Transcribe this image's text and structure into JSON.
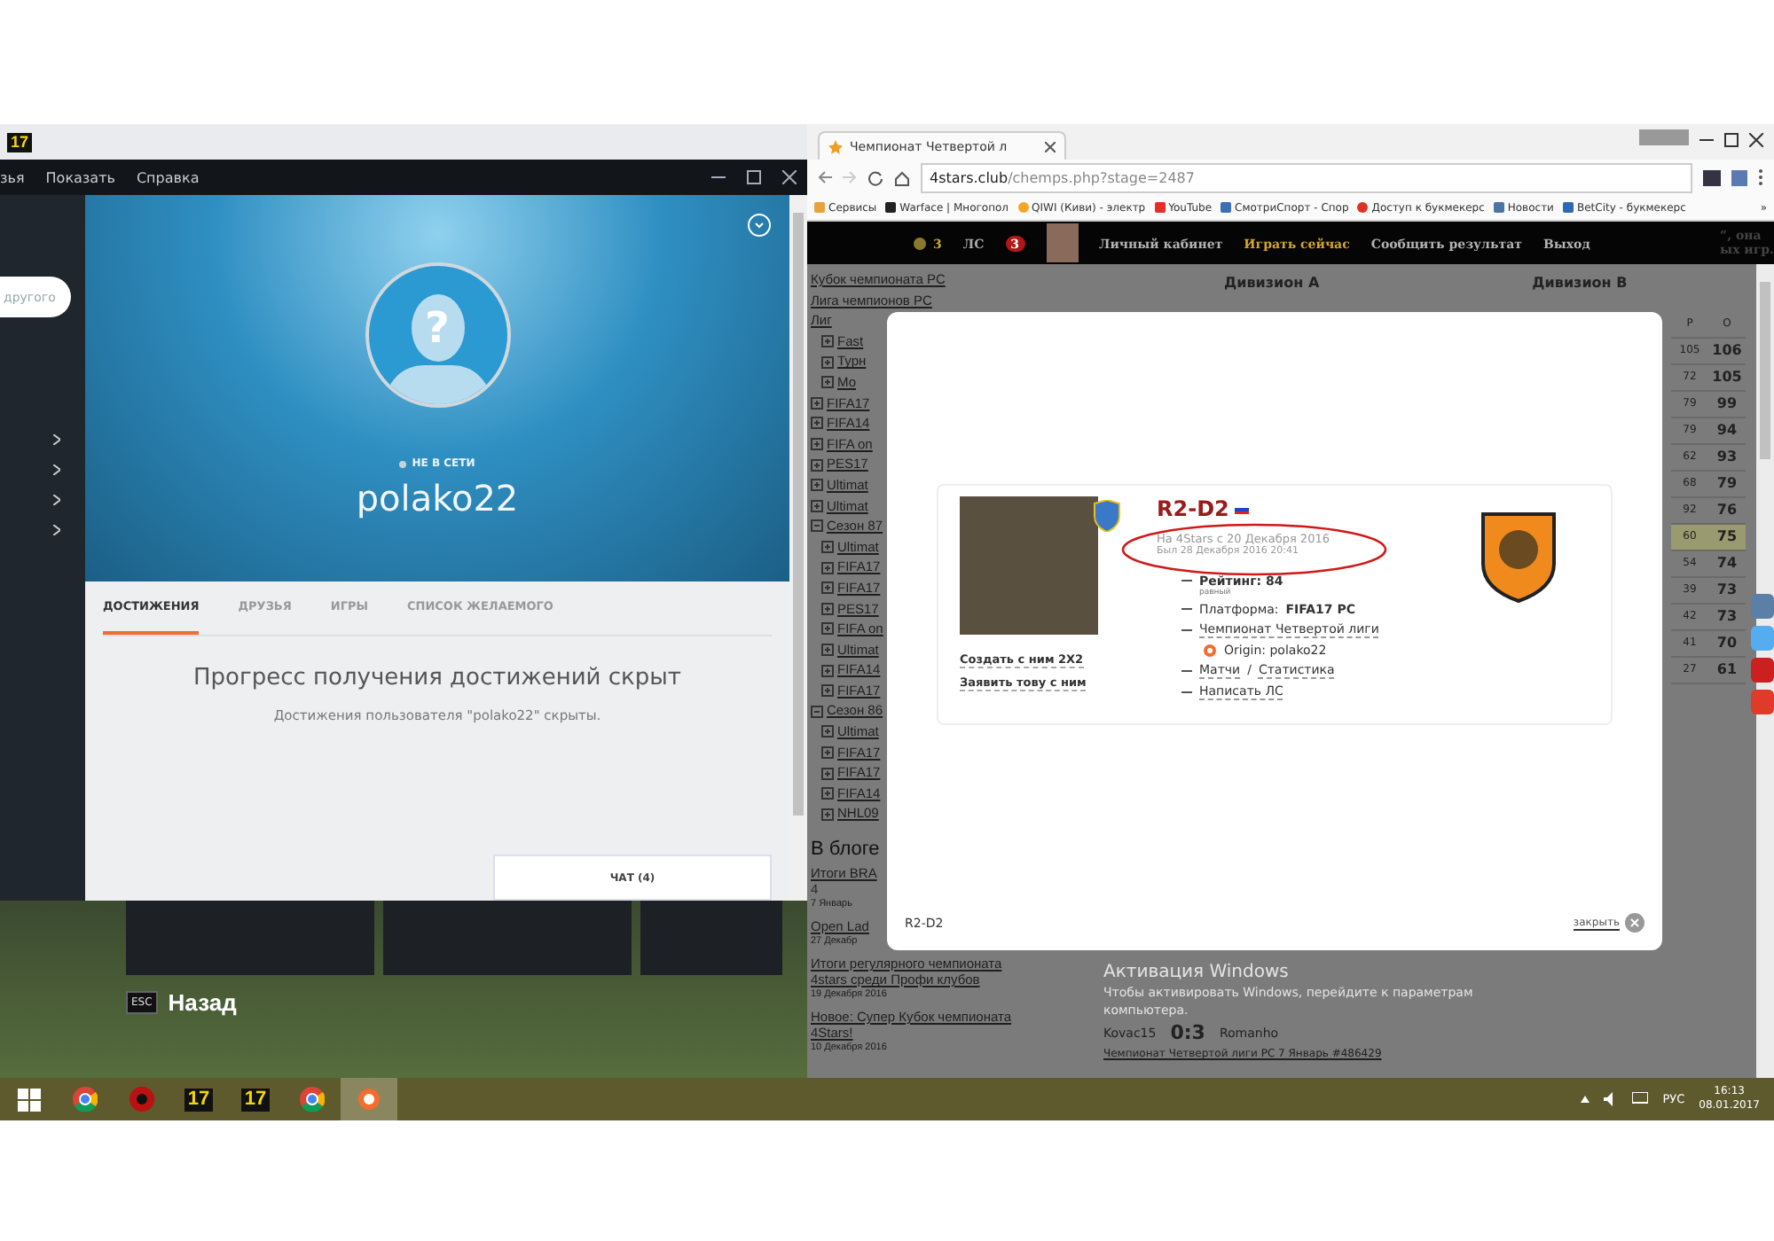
{
  "game_window": {
    "icon_label": "17",
    "back_key": "ESC",
    "back_label": "Назад"
  },
  "origin": {
    "menu": [
      "зья",
      "Показать",
      "Справка"
    ],
    "search": {
      "placeholder": "другого"
    },
    "sidebar_items": [
      {
        "kind": "chevron"
      },
      {
        "kind": "chevron"
      },
      {
        "kind": "chevron"
      },
      {
        "kind": "chevron"
      }
    ],
    "profile": {
      "avatar_mark": "?",
      "status": "НЕ В СЕТИ",
      "online": false,
      "username": "polako22"
    },
    "tabs": [
      {
        "label": "ДОСТИЖЕНИЯ",
        "selected": true
      },
      {
        "label": "ДРУЗЬЯ",
        "selected": false
      },
      {
        "label": "ИГРЫ",
        "selected": false
      },
      {
        "label": "СПИСОК ЖЕЛАЕМОГО",
        "selected": false
      }
    ],
    "message": {
      "title": "Прогресс получения достижений скрыт",
      "text": "Достижения пользователя \"polako22\" скрыты."
    },
    "chat": {
      "label": "ЧАТ (4)"
    }
  },
  "browser": {
    "tab_title": "Чемпионат Четвертой л",
    "address": {
      "host": "4stars.club",
      "path": "/chemps.php?stage=2487"
    },
    "bookmarks": [
      {
        "kind": "apps",
        "label": "Сервисы"
      },
      {
        "kind": "warface",
        "label": "Warface | Многопол"
      },
      {
        "kind": "qiwi",
        "label": "QIWI (Киви) - электр"
      },
      {
        "kind": "youtube",
        "label": "YouTube"
      },
      {
        "kind": "tv",
        "label": "СмотриСпорт - Спор"
      },
      {
        "kind": "red",
        "label": "Доступ к букмекерс"
      },
      {
        "kind": "vk",
        "label": "Новости"
      },
      {
        "kind": "betcity",
        "label": "BetCity - букмекерс"
      }
    ],
    "more": "»"
  },
  "site": {
    "coins": "3",
    "messages_label": "ЛС",
    "messages_count": "3",
    "nav": [
      {
        "label": "Личный кабинет",
        "selected": false
      },
      {
        "label": "Играть сейчас",
        "selected": true
      },
      {
        "label": "Сообщить результат",
        "selected": false
      },
      {
        "label": "Выход",
        "selected": false
      }
    ],
    "side_fragments": [
      "“, она",
      "ых игр."
    ],
    "links": [
      "Кубок чемпионата PC",
      "Лига чемпионов PC"
    ],
    "tree": [
      {
        "label": "Лиг",
        "children": [
          {
            "label": "Fast",
            "expanded": false
          },
          {
            "label": "Турн",
            "expanded": false
          },
          {
            "label": "Мо",
            "expanded": false
          }
        ]
      },
      {
        "label": "FIFA17",
        "expanded": false
      },
      {
        "label": "FIFA14",
        "expanded": false
      },
      {
        "label": "FIFA on",
        "expanded": false
      },
      {
        "label": "PES17",
        "expanded": false
      },
      {
        "label": "Ultimat",
        "expanded": false
      },
      {
        "label": "Ultimat",
        "expanded": false
      },
      {
        "label": "Сезон 87",
        "expanded": true,
        "children": [
          {
            "label": "Ultimat",
            "expanded": false
          },
          {
            "label": "FIFA17",
            "expanded": false
          },
          {
            "label": "FIFA17",
            "expanded": false
          },
          {
            "label": "PES17",
            "expanded": false
          },
          {
            "label": "FIFA on",
            "expanded": false
          },
          {
            "label": "Ultimat",
            "expanded": false
          },
          {
            "label": "FIFA14",
            "expanded": false
          },
          {
            "label": "FIFA17",
            "expanded": false
          }
        ]
      },
      {
        "label": "Сезон 86",
        "expanded": true,
        "children": [
          {
            "label": "Ultimat",
            "expanded": false
          },
          {
            "label": "FIFA17",
            "expanded": false
          },
          {
            "label": "FIFA17",
            "expanded": false
          },
          {
            "label": "FIFA14",
            "expanded": false
          },
          {
            "label": "NHL09",
            "expanded": false
          }
        ]
      }
    ],
    "divisions": [
      "Дивизион А",
      "Дивизион В"
    ],
    "standings": {
      "columns": [
        "Р",
        "О"
      ],
      "rows": [
        {
          "cells": [
            "105",
            "106"
          ],
          "selected": false
        },
        {
          "cells": [
            "72",
            "105"
          ],
          "selected": false
        },
        {
          "cells": [
            "79",
            "99"
          ],
          "selected": false
        },
        {
          "cells": [
            "79",
            "94"
          ],
          "selected": false
        },
        {
          "cells": [
            "62",
            "93"
          ],
          "selected": false
        },
        {
          "cells": [
            "68",
            "79"
          ],
          "selected": false
        },
        {
          "cells": [
            "92",
            "76"
          ],
          "selected": false
        },
        {
          "cells": [
            "60",
            "75"
          ],
          "selected": true
        },
        {
          "cells": [
            "54",
            "74"
          ],
          "selected": false
        },
        {
          "cells": [
            "39",
            "73"
          ],
          "selected": false
        },
        {
          "cells": [
            "42",
            "73"
          ],
          "selected": false
        },
        {
          "cells": [
            "41",
            "70"
          ],
          "selected": false
        },
        {
          "cells": [
            "27",
            "61"
          ],
          "selected": false
        }
      ]
    },
    "blog": {
      "title": "В блоге",
      "posts": [
        {
          "title": "Итоги BRA",
          "extra": "4",
          "date": "7 Январь"
        },
        {
          "title": "Open Lad",
          "date": "27 Декабр"
        },
        {
          "title": "Итоги регулярного чемпионата 4stars среди Профи клубов",
          "date": "19 Декабря 2016"
        },
        {
          "title": "Новое: Супер Кубок чемпионата 4Stars!",
          "date": "10 Декабря 2016"
        }
      ]
    },
    "activation": [
      "Активация Windows",
      "Чтобы активировать Windows, перейдите к параметрам",
      "компьютера."
    ],
    "match": {
      "home": "Kovac15",
      "score": "0:3",
      "away": "Romanho"
    },
    "match_link": "Чемпионат Четвертой лиги PC 7 Январь #486429"
  },
  "modal": {
    "player": {
      "name": "R2-D2",
      "joined": "На 4Stars с 20 Декабря 2016",
      "last_seen": "Был 28 Декабря 2016 20:41",
      "rating": "Рейтинг: 84",
      "rating_note": "равный",
      "platform_label": "Платформа:",
      "platform": "FIFA17 PC",
      "league": "Чемпионат Четвертой лиги",
      "origin": "Origin: polako22",
      "matches": "Матчи",
      "separator": "/",
      "stats": "Статистика",
      "message": "Написать ЛС"
    },
    "actions": [
      "Создать с ним 2X2",
      "Заявить тову с ним"
    ],
    "caption": "R2-D2",
    "close": "закрыть"
  },
  "taskbar": {
    "apps": [
      {
        "kind": "windows",
        "selected": false
      },
      {
        "kind": "chrome",
        "selected": false
      },
      {
        "kind": "red",
        "selected": false
      },
      {
        "kind": "fifa",
        "label": "17",
        "selected": false
      },
      {
        "kind": "fifa",
        "label": "17",
        "selected": false
      },
      {
        "kind": "chrome",
        "selected": false
      },
      {
        "kind": "origin",
        "selected": true
      }
    ],
    "lang": "РУС",
    "time": "16:13",
    "date": "08.01.2017"
  }
}
